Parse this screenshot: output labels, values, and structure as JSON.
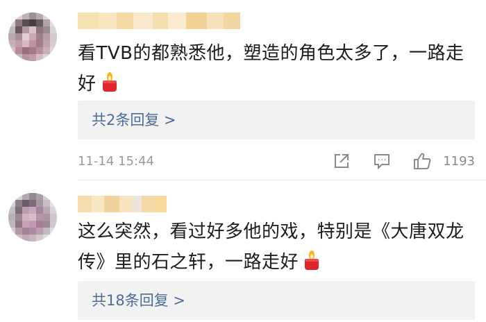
{
  "colors": {
    "text": "#1c1c1c",
    "link": "#4b6c9a",
    "muted": "#9a9a9a",
    "reply_background": "#f2f2f2"
  },
  "comments": [
    {
      "text": "看TVB的都熟悉他，塑造的角色太多了，一路走好",
      "emoji": "candle-icon",
      "replies_label": "共2条回复 >",
      "timestamp": "11-14 15:44",
      "actions": [
        "share-icon",
        "comment-icon",
        "like-icon"
      ],
      "likes": "1193"
    },
    {
      "text": "这么突然，看过好多他的戏，特别是《大唐双龙传》里的石之轩，一路走好",
      "emoji": "candle-icon",
      "replies_label": "共18条回复 >"
    }
  ]
}
